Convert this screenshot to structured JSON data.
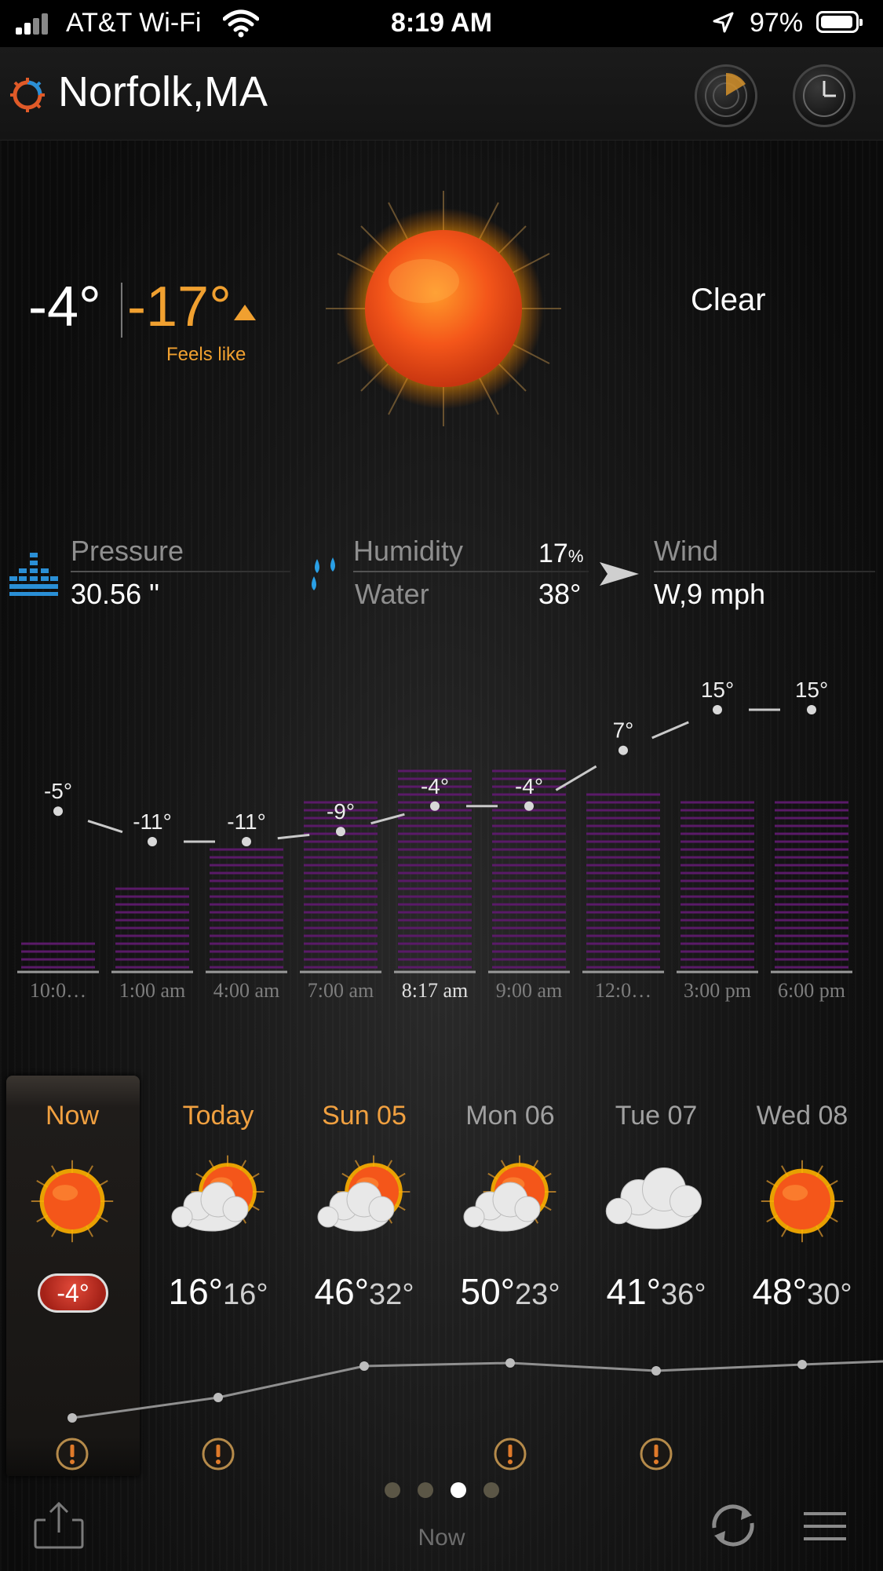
{
  "status_bar": {
    "carrier": "AT&T Wi-Fi",
    "time": "8:19 AM",
    "battery": "97%"
  },
  "header": {
    "location": "Norfolk,MA"
  },
  "current": {
    "temp": "-4°",
    "feels_like_temp": "-17°",
    "feels_like_label": "Feels like",
    "condition": "Clear"
  },
  "details": {
    "pressure_label": "Pressure",
    "pressure_value": "30.56 \"",
    "humidity_label": "Humidity",
    "humidity_value": "17",
    "humidity_unit": "%",
    "water_label": "Water",
    "water_value": "38°",
    "wind_label": "Wind",
    "wind_value": "W,9 mph"
  },
  "hourly": {
    "times": [
      "10:0…",
      "1:00 am",
      "4:00 am",
      "7:00 am",
      "8:17 am",
      "9:00 am",
      "12:0…",
      "3:00 pm",
      "6:00 pm"
    ],
    "temps": [
      -5,
      -11,
      -11,
      -9,
      -4,
      -4,
      7,
      15,
      15
    ],
    "temp_labels": [
      "-5°",
      "-11°",
      "-11°",
      "-9°",
      "-4°",
      "-4°",
      "7°",
      "15°",
      "15°"
    ],
    "bar_levels": [
      0.14,
      0.43,
      0.62,
      0.83,
      1.0,
      1.0,
      0.9,
      0.83,
      0.83
    ],
    "current_index": 4,
    "colors": {
      "bar": "#5a1a68",
      "line": "#c9c9c9"
    }
  },
  "daily": {
    "days": [
      {
        "label": "Now",
        "icon": "sun-icon",
        "hi": "",
        "lo": "",
        "badge": "-4°",
        "alert": true
      },
      {
        "label": "Today",
        "icon": "partly-cloudy-icon",
        "hi": "16°",
        "lo": "16°",
        "alert": true
      },
      {
        "label": "Sun 05",
        "icon": "partly-cloudy-icon",
        "hi": "46°",
        "lo": "32°",
        "alert": false
      },
      {
        "label": "Mon 06",
        "icon": "partly-cloudy-icon",
        "hi": "50°",
        "lo": "23°",
        "alert": true
      },
      {
        "label": "Tue 07",
        "icon": "cloud-icon",
        "hi": "41°",
        "lo": "36°",
        "alert": true
      },
      {
        "label": "Wed 08",
        "icon": "sun-icon",
        "hi": "48°",
        "lo": "30°",
        "alert": false
      }
    ],
    "highlight_colors": {
      "today_label": "#f0a040",
      "other_label": "#a0a0a0"
    }
  },
  "bottom": {
    "label": "Now",
    "pager_active_index": 2,
    "pager_count": 4
  }
}
